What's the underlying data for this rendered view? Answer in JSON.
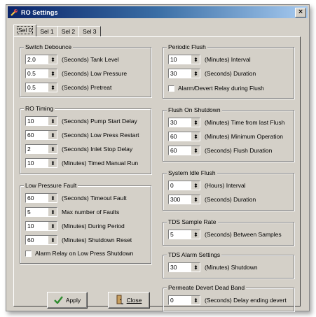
{
  "window": {
    "title": "RO Settings",
    "close_glyph": "×"
  },
  "tabs": [
    "Sel 0",
    "Sel 1",
    "Sel 2",
    "Sel 3"
  ],
  "switch_debounce": {
    "title": "Switch Debounce",
    "rows": [
      {
        "value": "2.0",
        "label": "(Seconds) Tank Level"
      },
      {
        "value": "0.5",
        "label": "(Seconds) Low Pressure"
      },
      {
        "value": "0.5",
        "label": "(Seconds) Pretreat"
      }
    ]
  },
  "ro_timing": {
    "title": "RO Timing",
    "rows": [
      {
        "value": "10",
        "label": "(Seconds) Pump Start Delay"
      },
      {
        "value": "60",
        "label": "(Seconds) Low Press Restart"
      },
      {
        "value": "2",
        "label": "(Seconds) Inlet Stop Delay"
      },
      {
        "value": "10",
        "label": "(Minutes) Timed Manual Run"
      }
    ]
  },
  "low_pressure_fault": {
    "title": "Low Pressure Fault",
    "rows": [
      {
        "value": "60",
        "label": "(Seconds) Timeout Fault"
      },
      {
        "value": "5",
        "label": "Max number of Faults"
      },
      {
        "value": "10",
        "label": "(Minutes) During Period"
      },
      {
        "value": "60",
        "label": "(Minutes) Shutdown Reset"
      }
    ],
    "checkbox": "Alarm Relay on Low Press Shutdown"
  },
  "periodic_flush": {
    "title": "Periodic Flush",
    "rows": [
      {
        "value": "10",
        "label": "(Minutes) Interval"
      },
      {
        "value": "30",
        "label": "(Seconds) Duration"
      }
    ],
    "checkbox": "Alarm/Devert Relay during Flush"
  },
  "flush_on_shutdown": {
    "title": "Flush On Shutdown",
    "rows": [
      {
        "value": "30",
        "label": "(Minutes) Time from last Flush"
      },
      {
        "value": "60",
        "label": "(Minutes) Minimum Operation"
      },
      {
        "value": "60",
        "label": "(Seconds) Flush Duration"
      }
    ]
  },
  "system_idle_flush": {
    "title": "System Idle Flush",
    "rows": [
      {
        "value": "0",
        "label": "(Hours) Interval"
      },
      {
        "value": "300",
        "label": "(Seconds) Duration"
      }
    ]
  },
  "tds_sample_rate": {
    "title": "TDS Sample Rate",
    "rows": [
      {
        "value": "5",
        "label": "(Seconds) Between Samples"
      }
    ]
  },
  "tds_alarm_settings": {
    "title": "TDS Alarm Settings",
    "rows": [
      {
        "value": "30",
        "label": "(Minutes) Shutdown"
      }
    ]
  },
  "permeate_devert": {
    "title": "Permeate Devert Dead Band",
    "rows": [
      {
        "value": "0",
        "label": "(Seconds) Delay ending devert"
      }
    ]
  },
  "buttons": {
    "apply": "Apply",
    "close": "Close"
  },
  "spin_glyph": "⬍",
  "colors": {
    "title_start": "#0a246a",
    "title_end": "#a6caf0",
    "face": "#d4d0c8",
    "apply_check": "#2e8b2e"
  }
}
